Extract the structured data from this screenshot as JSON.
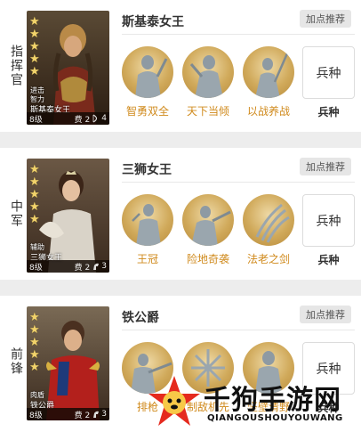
{
  "heroes": [
    {
      "position": "指挥官",
      "title": "斯基泰女王",
      "recommend_label": "加点推荐",
      "portrait": {
        "role": "进击",
        "role2": "智力",
        "name": "斯基泰女王",
        "level": "8级",
        "cost": "费 2",
        "troop_count": "4"
      },
      "skills": [
        "智勇双全",
        "天下当倾",
        "以战养战"
      ],
      "troop_box": "兵种",
      "troop_label": "兵种"
    },
    {
      "position": "中军",
      "title": "三狮女王",
      "recommend_label": "加点推荐",
      "portrait": {
        "role": "辅助",
        "role2": "",
        "name": "三狮女王",
        "level": "8级",
        "cost": "费 2",
        "troop_count": "3"
      },
      "skills": [
        "王冠",
        "险地奇袭",
        "法老之剑"
      ],
      "troop_box": "兵种",
      "troop_label": "兵种"
    },
    {
      "position": "前锋",
      "title": "铁公爵",
      "recommend_label": "加点推荐",
      "portrait": {
        "role": "肉盾",
        "role2": "",
        "name": "铁公爵",
        "level": "8级",
        "cost": "费 2",
        "troop_count": "3"
      },
      "skills": [
        "排枪",
        "制敌机先",
        "坚壁清野"
      ],
      "troop_box": "兵种",
      "troop_label": "兵种"
    }
  ],
  "watermark": {
    "title": "千狗手游网",
    "sub": "QIANGOUSHOUYOUWANG"
  },
  "colors": {
    "skill_label": "#d08a1c",
    "star": "#f2d36b",
    "button_bg": "#e6e6e6"
  }
}
